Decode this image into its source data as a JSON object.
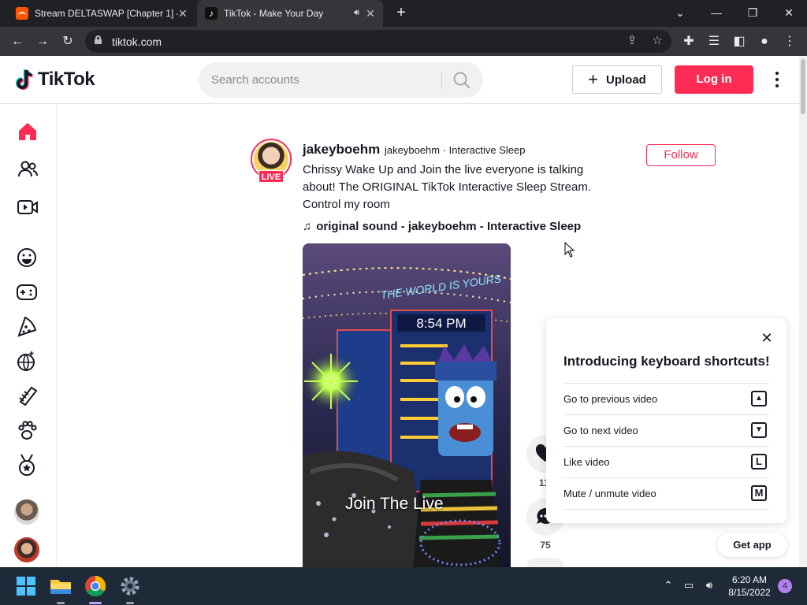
{
  "browser": {
    "tabs": [
      {
        "title": "Stream DELTASWAP [Chapter 1] - ...",
        "favicon": "soundcloud-icon"
      },
      {
        "title": "TikTok - Make Your Day",
        "favicon": "tiktok-icon",
        "active": true
      }
    ],
    "url": "tiktok.com"
  },
  "header": {
    "logo_text": "TikTok",
    "search_placeholder": "Search accounts",
    "upload_label": "Upload",
    "login_label": "Log in"
  },
  "post": {
    "username": "jakeyboehm",
    "nickname": "jakeyboehm · Interactive Sleep",
    "live_badge": "LIVE",
    "follow_label": "Follow",
    "caption": "Chrissy Wake Up and Join the live everyone is talking about! The ORIGINAL TikTok Interactive Sleep Stream. Control my room",
    "sound": "original sound - jakeyboehm - Interactive Sleep",
    "video_caption": "Join The Live",
    "video_clock": "8:54 PM",
    "like_count": "11.",
    "comment_count": "75"
  },
  "shortcuts": {
    "title": "Introducing keyboard shortcuts!",
    "rows": [
      {
        "label": "Go to previous video",
        "key": "▲"
      },
      {
        "label": "Go to next video",
        "key": "▼"
      },
      {
        "label": "Like video",
        "key": "L"
      },
      {
        "label": "Mute / unmute video",
        "key": "M"
      }
    ]
  },
  "get_app_label": "Get app",
  "taskbar": {
    "time": "6:20 AM",
    "date": "8/15/2022",
    "notifications": "4"
  },
  "colors": {
    "brand": "#fe2c55",
    "text": "#161823",
    "chrome_dark": "#202124",
    "taskbar": "#1f2a38"
  }
}
